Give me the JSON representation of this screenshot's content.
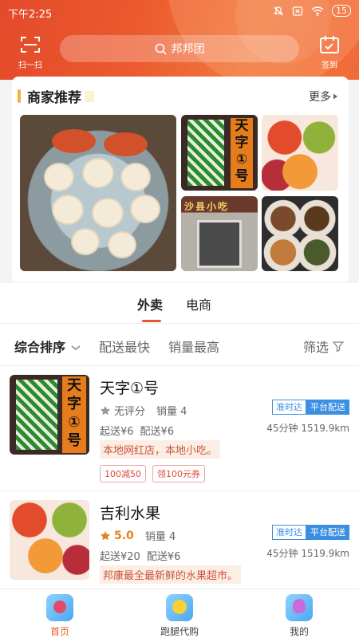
{
  "status_bar": {
    "time": "下午2:25",
    "battery": "15"
  },
  "header": {
    "scan_label": "扫一扫",
    "search_text": "邦邦团",
    "checkin_label": "签到"
  },
  "recommend": {
    "title": "商家推荐",
    "more": "更多",
    "sign_top": "天",
    "sign_mid": "字",
    "sign_num": "①",
    "sign_last": "号",
    "shop_sign": "沙县小吃"
  },
  "tabs": [
    {
      "label": "外卖"
    },
    {
      "label": "电商"
    }
  ],
  "sort": {
    "comprehensive": "综合排序",
    "fastest": "配送最快",
    "top_sales": "销量最高",
    "filter": "筛选"
  },
  "stores": [
    {
      "name": "天字①号",
      "score": "无评分",
      "sales": "销量 4",
      "min_order": "起送¥6",
      "delivery_fee": "配送¥6",
      "eta": "45分钟 1519.9km",
      "badge_ontime": "准时达",
      "badge_platform": "平台配送",
      "desc": "本地网红店，本地小吃。",
      "coupons": [
        "100减50",
        "领100元券"
      ]
    },
    {
      "name": "吉利水果",
      "score": "5.0",
      "sales": "销量 4",
      "min_order": "起送¥20",
      "delivery_fee": "配送¥6",
      "eta": "45分钟 1519.9km",
      "badge_ontime": "准时达",
      "badge_platform": "平台配送",
      "desc": "邦康最全最新鲜的水果超市。"
    }
  ],
  "tabbar": [
    {
      "label": "首页",
      "icon": "home-icon"
    },
    {
      "label": "跑腿代购",
      "icon": "errand-icon"
    },
    {
      "label": "我的",
      "icon": "profile-icon"
    }
  ],
  "colors": {
    "accent": "#e8562e",
    "blue_badge": "#3a8fe0",
    "star": "#e4811b"
  }
}
